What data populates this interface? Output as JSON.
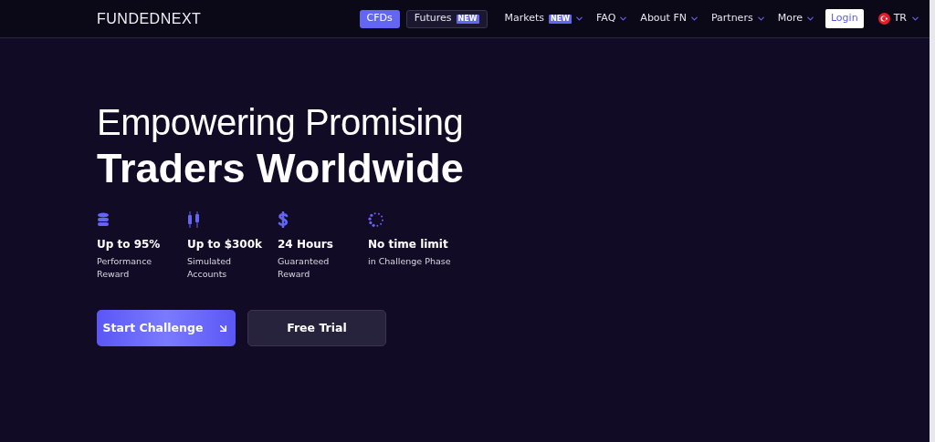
{
  "logo": "FUNDEDNEXT",
  "product_tabs": [
    {
      "label": "CFDs",
      "selected": true
    },
    {
      "label": "Futures",
      "badge": "NEW",
      "selected": false
    }
  ],
  "nav": [
    {
      "label": "Markets",
      "badge": "NEW"
    },
    {
      "label": "FAQ"
    },
    {
      "label": "About FN"
    },
    {
      "label": "Partners"
    },
    {
      "label": "More"
    }
  ],
  "login": "Login",
  "language": "TR",
  "hero": {
    "title_line_1": "Empowering Promising",
    "title_line_2": "Traders Worldwide"
  },
  "features": [
    {
      "kind": "coins",
      "value": "Up to 95%",
      "caption_1": "Performance",
      "caption_2": "Reward"
    },
    {
      "kind": "candles",
      "value": "Up to $300k",
      "caption_1": "Simulated",
      "caption_2": "Accounts"
    },
    {
      "kind": "dollar",
      "value": "24 Hours",
      "caption_1": "Guaranteed",
      "caption_2": "Reward"
    },
    {
      "kind": "spinner",
      "value": "No time limit",
      "caption_1": "in Challenge Phase"
    }
  ],
  "buttons": {
    "primary": "Start Challenge",
    "secondary": "Free Trial"
  }
}
